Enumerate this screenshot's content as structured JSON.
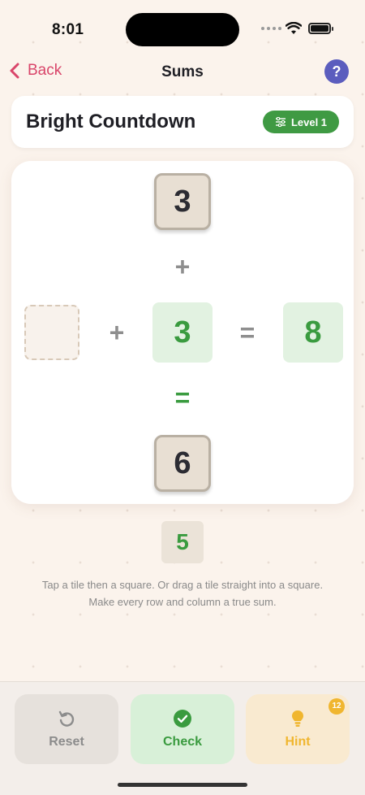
{
  "status_bar": {
    "time": "8:01"
  },
  "nav": {
    "back_label": "Back",
    "title": "Sums",
    "help_label": "?"
  },
  "puzzle": {
    "title": "Bright Countdown",
    "level_label": "Level 1"
  },
  "board": {
    "top_tile": "3",
    "col_op_1": "+",
    "row_op_1": "+",
    "center_given": "3",
    "row_equals": "=",
    "row_result": "8",
    "col_equals": "=",
    "bottom_tile": "6"
  },
  "tray": {
    "tiles": [
      "5"
    ]
  },
  "instructions": {
    "line1": "Tap a tile then a square. Or drag a tile straight into a square.",
    "line2": "Make every row and column a true sum."
  },
  "actions": {
    "reset_label": "Reset",
    "check_label": "Check",
    "hint_label": "Hint",
    "hint_count": "12"
  },
  "colors": {
    "accent_green": "#3a9b3f",
    "back_pink": "#d9456a",
    "help_purple": "#5b5dbe",
    "hint_yellow": "#f0b62f"
  }
}
